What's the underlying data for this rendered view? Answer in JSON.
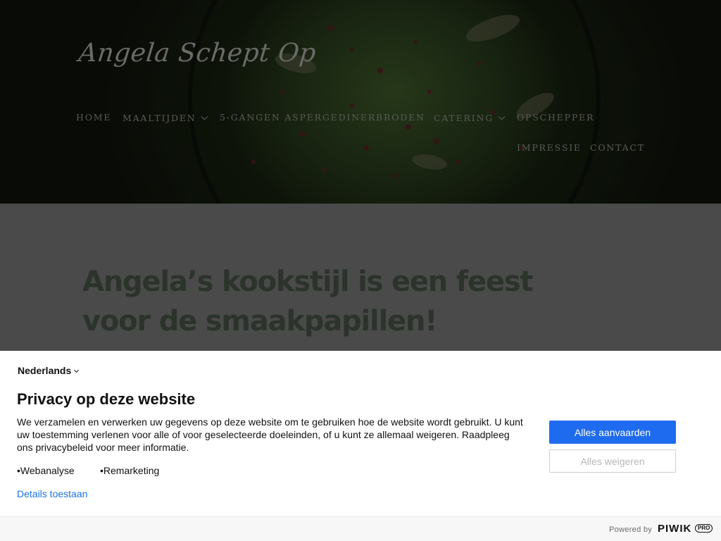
{
  "site": {
    "logo": "Angela Schept Op",
    "nav": [
      {
        "label": "Home",
        "has_dropdown": false
      },
      {
        "label": "Maaltijden",
        "has_dropdown": true
      },
      {
        "label": "5-gangen aspergediner",
        "has_dropdown": false
      },
      {
        "label": "Broden",
        "has_dropdown": false
      },
      {
        "label": "Catering",
        "has_dropdown": true
      },
      {
        "label": "Opschepper",
        "has_dropdown": false
      },
      {
        "label": "Impressie",
        "has_dropdown": false
      },
      {
        "label": "Contact",
        "has_dropdown": false
      }
    ],
    "headline": "Angela’s kookstijl is een feest voor de smaakpapillen!"
  },
  "consent": {
    "language": "Nederlands",
    "title": "Privacy op deze website",
    "description": "We verzamelen en verwerken uw gegevens op deze website om te gebruiken hoe de website wordt gebruikt. U kunt uw toestemming verlenen voor alle of voor geselecteerde doeleinden, of u kunt ze allemaal weigeren. Raadpleeg ons privacybeleid voor meer informatie.",
    "purposes": [
      "Webanalyse",
      "Remarketing"
    ],
    "details_link": "Details toestaan",
    "accept_all": "Alles aanvaarden",
    "reject_all": "Alles weigeren",
    "powered_by": "Powered by",
    "brand": "PIWIK",
    "brand_badge": "PRO"
  },
  "colors": {
    "accept_button": "#1f6bef",
    "link": "#1a73d9",
    "overlay_dim": "#4a4a4a"
  }
}
